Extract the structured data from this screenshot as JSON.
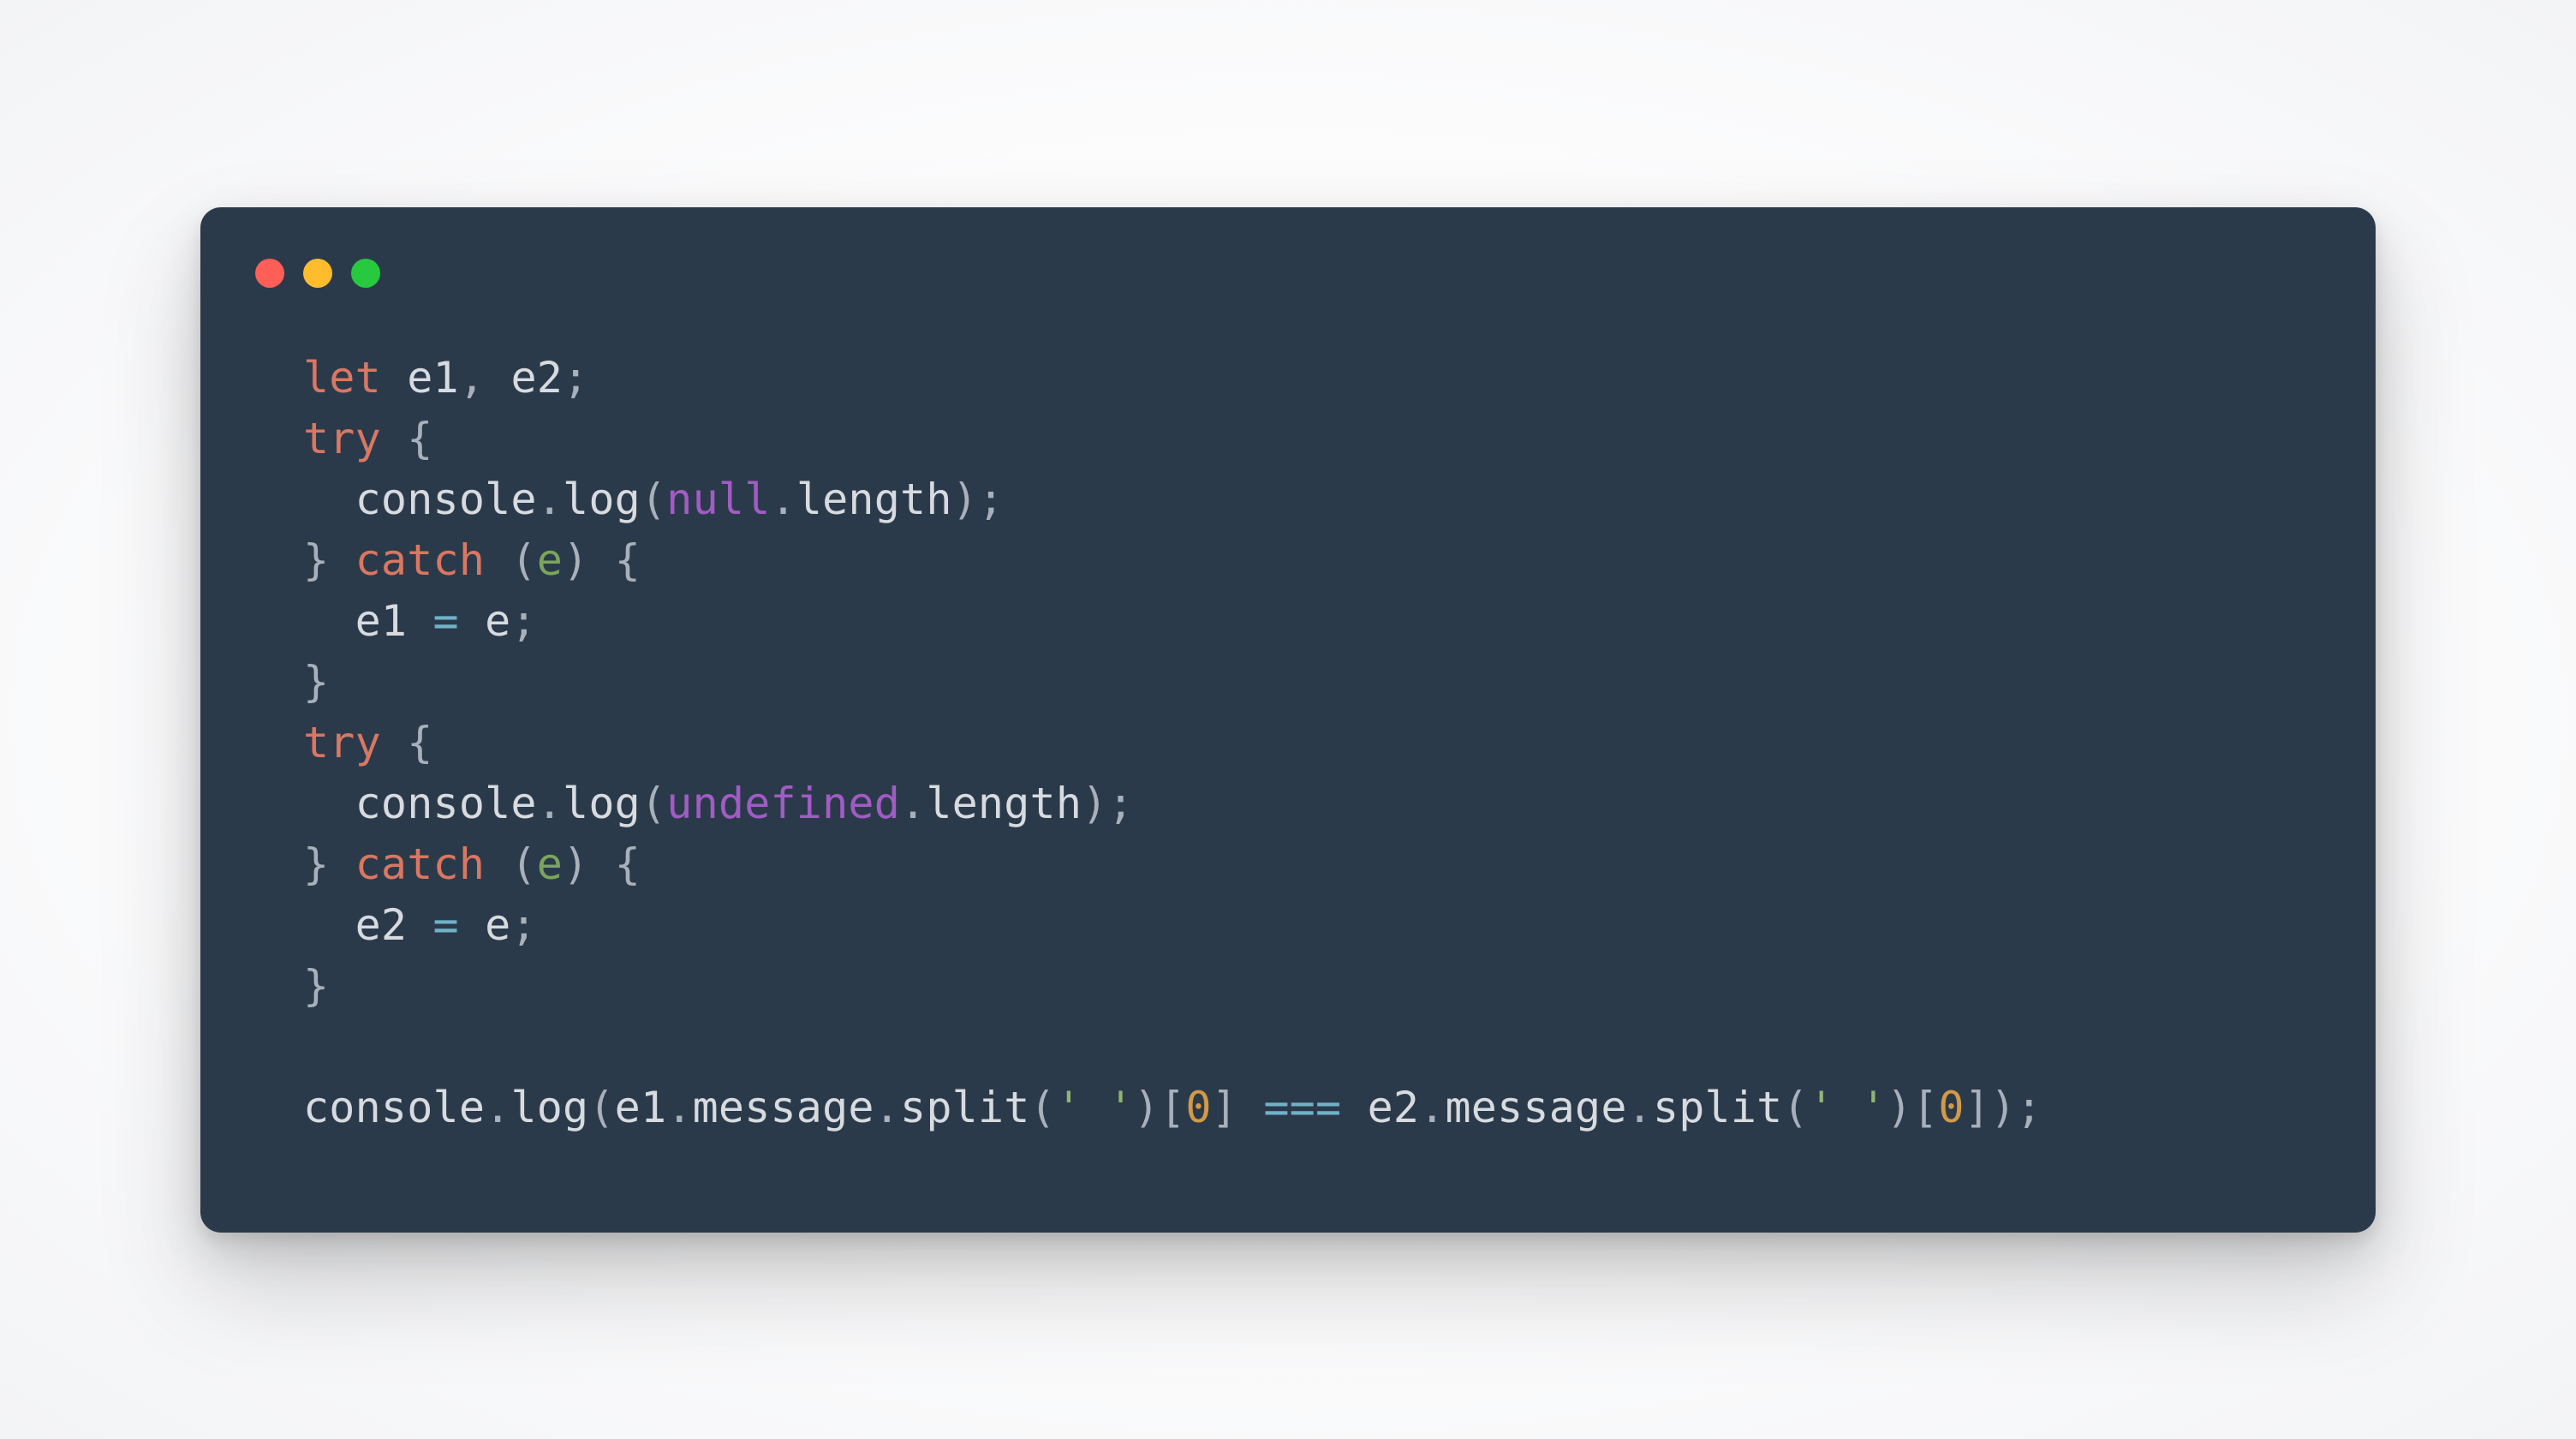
{
  "window": {
    "traffic_light_colors": {
      "red": "#ff5f56",
      "yellow": "#ffbd2e",
      "green": "#27c93f"
    },
    "background": "#2b3a4a"
  },
  "tok": {
    "let": "let",
    "try": "try",
    "catch": "catch",
    "null": "null",
    "undefined": "undefined",
    "console": "console",
    "log": "log",
    "length": "length",
    "message": "message",
    "split": "split",
    "e": "e",
    "e1": "e1",
    "e2": "e2",
    "zero": "0",
    "space_str": "' '",
    "eq": "=",
    "tripleeq": "===",
    "comma": ",",
    "semi": ";",
    "dot": ".",
    "lbrace": "{",
    "rbrace": "}",
    "lparen": "(",
    "rparen": ")",
    "lbracket": "[",
    "rbracket": "]"
  },
  "code_plain": "let e1, e2;\ntry {\n  console.log(null.length);\n} catch (e) {\n  e1 = e;\n}\ntry {\n  console.log(undefined.length);\n} catch (e) {\n  e2 = e;\n}\n\nconsole.log(e1.message.split(' ')[0] === e2.message.split(' ')[0]);"
}
